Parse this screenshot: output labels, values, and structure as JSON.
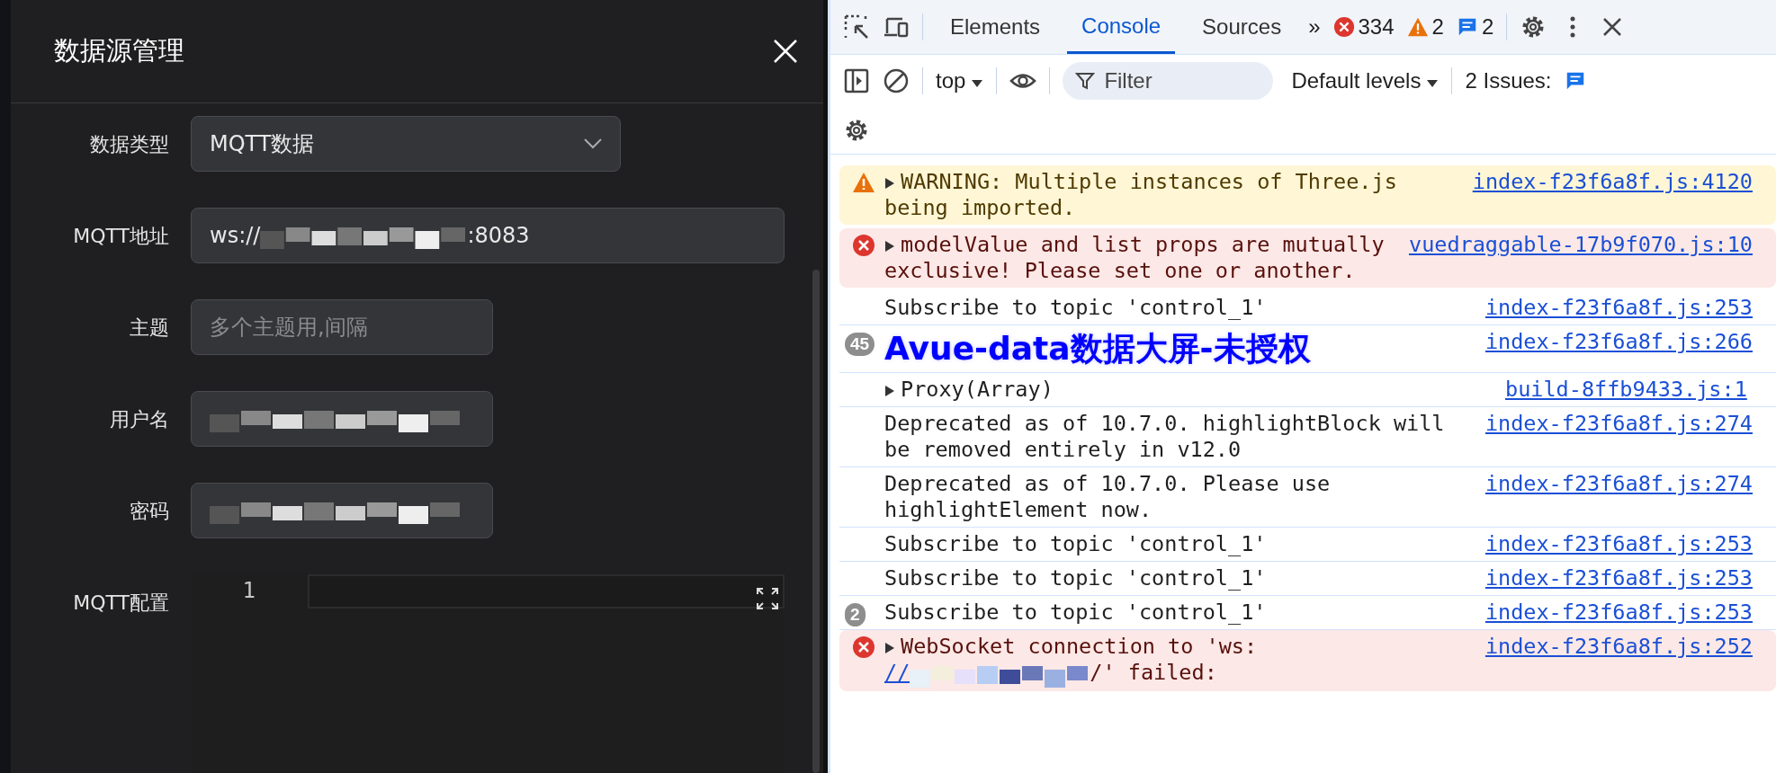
{
  "dialog": {
    "title": "数据源管理",
    "fields": [
      {
        "kind": "select",
        "label": "数据类型",
        "value": "MQTT数据"
      },
      {
        "kind": "redacted",
        "label": "MQTT地址",
        "prefix": "ws://",
        "suffix": ":8083",
        "wide": true
      },
      {
        "kind": "input",
        "label": "主题",
        "placeholder": "多个主题用,间隔"
      },
      {
        "kind": "redacted",
        "label": "用户名",
        "wide": false
      },
      {
        "kind": "redacted",
        "label": "密码",
        "wide": false
      },
      {
        "kind": "editor",
        "label": "MQTT配置",
        "line_number": "1"
      }
    ]
  },
  "devtools": {
    "tabs": [
      {
        "label": "Elements",
        "selected": false
      },
      {
        "label": "Console",
        "selected": true
      },
      {
        "label": "Sources",
        "selected": false
      }
    ],
    "more": "»",
    "errors": "334",
    "warnings": "2",
    "infos": "2",
    "context": "top",
    "filter": {
      "placeholder": "Filter"
    },
    "levels": "Default levels",
    "issues": "2 Issues:",
    "messages": [
      {
        "kind": "warning",
        "text": "WARNING: Multiple instances of Three.js being imported.",
        "source": "index-f23f6a8f.js:4120"
      },
      {
        "kind": "error",
        "text": "modelValue and list props are mutually exclusive! Please set one or another.",
        "source": "vuedraggable-17b9f070.js:10"
      },
      {
        "kind": "log",
        "text": "Subscribe to topic 'control_1'",
        "source": "index-f23f6a8f.js:253"
      },
      {
        "kind": "styled",
        "count": "45",
        "text": "Avue-data数据大屏-未授权",
        "source": "index-f23f6a8f.js:266"
      },
      {
        "kind": "object",
        "text": "Proxy(Array)",
        "source": "build-8ffb9433.js:1"
      },
      {
        "kind": "log",
        "text": "Deprecated as of 10.7.0. highlightBlock will be removed entirely in v12.0",
        "source": "index-f23f6a8f.js:274"
      },
      {
        "kind": "log",
        "text": "Deprecated as of 10.7.0. Please use highlightElement now.",
        "source": "index-f23f6a8f.js:274"
      },
      {
        "kind": "log",
        "text": "Subscribe to topic 'control_1'",
        "source": "index-f23f6a8f.js:253"
      },
      {
        "kind": "log",
        "text": "Subscribe to topic 'control_1'",
        "source": "index-f23f6a8f.js:253"
      },
      {
        "kind": "log",
        "count": "2",
        "text": "Subscribe to topic 'control_1'",
        "source": "index-f23f6a8f.js:253"
      },
      {
        "kind": "ws_error",
        "text": "WebSocket connection to 'ws:",
        "link": "//",
        "after": "/' failed:",
        "source": "index-f23f6a8f.js:252"
      }
    ]
  }
}
